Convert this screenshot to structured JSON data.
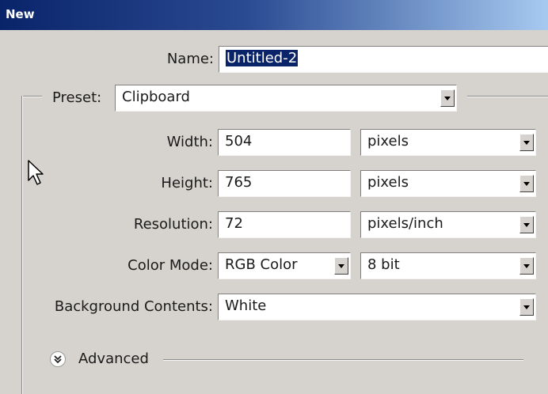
{
  "dialog": {
    "title": "New"
  },
  "name": {
    "label": "Name:",
    "value": "Untitled-2"
  },
  "preset": {
    "label": "Preset:",
    "value": "Clipboard"
  },
  "width": {
    "label": "Width:",
    "value": "504",
    "unit": "pixels"
  },
  "height": {
    "label": "Height:",
    "value": "765",
    "unit": "pixels"
  },
  "resolution": {
    "label": "Resolution:",
    "value": "72",
    "unit": "pixels/inch"
  },
  "color_mode": {
    "label": "Color Mode:",
    "value": "RGB Color",
    "depth": "8 bit"
  },
  "background": {
    "label": "Background Contents:",
    "value": "White"
  },
  "advanced": {
    "label": "Advanced"
  }
}
